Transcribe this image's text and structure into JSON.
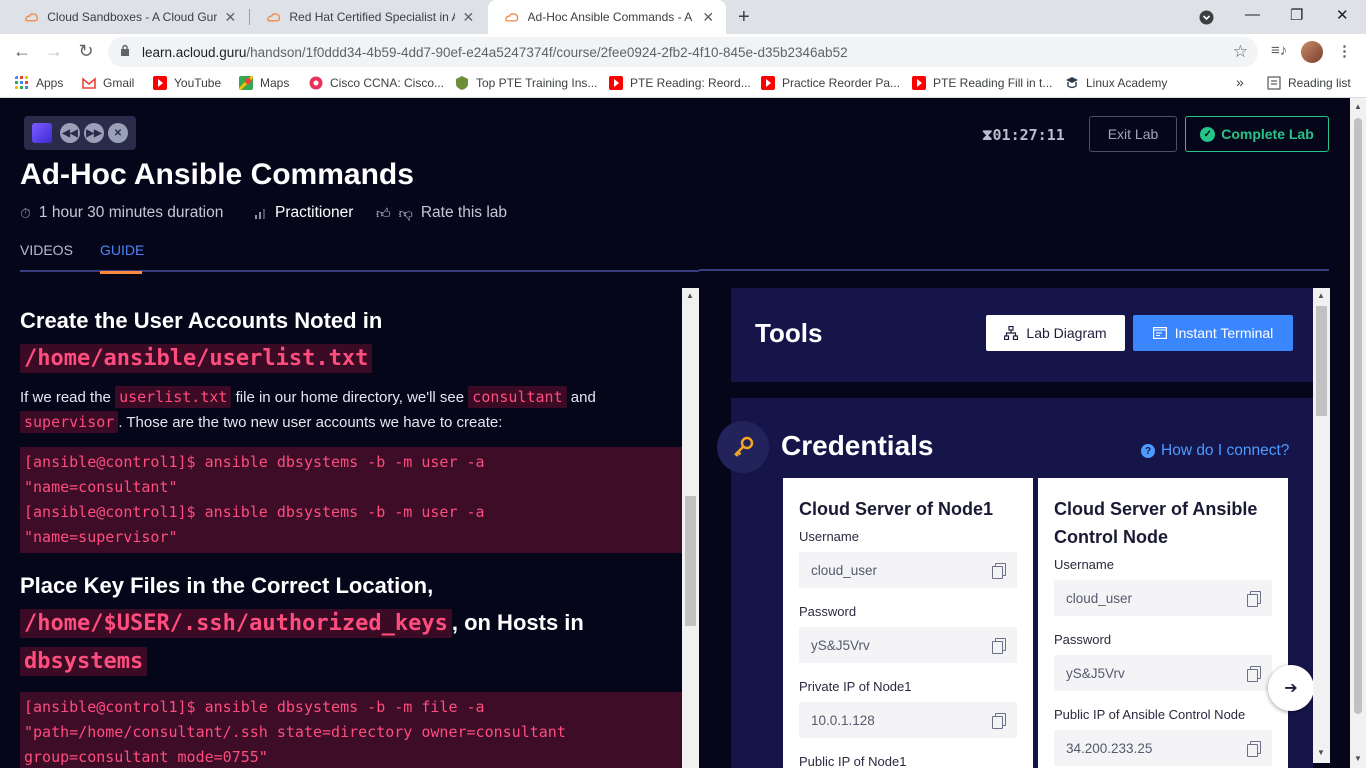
{
  "browser": {
    "tabs": [
      {
        "title": "Cloud Sandboxes - A Cloud Guru",
        "icon": "acloudguru-icon",
        "active": false
      },
      {
        "title": "Red Hat Certified Specialist in An",
        "icon": "acloudguru-icon",
        "active": false
      },
      {
        "title": "Ad-Hoc Ansible Commands - A C",
        "icon": "acloudguru-icon",
        "active": true
      }
    ],
    "url_host": "learn.acloud.guru",
    "url_path": "/handson/1f0ddd34-4b59-4dd7-90ef-e24a5247374f/course/2fee0924-2fb2-4f10-845e-d35b2346ab52",
    "bookmarks": [
      {
        "label": "Apps",
        "icon": "apps-grid-icon"
      },
      {
        "label": "Gmail",
        "icon": "gmail-icon"
      },
      {
        "label": "YouTube",
        "icon": "youtube-icon"
      },
      {
        "label": "Maps",
        "icon": "maps-icon"
      },
      {
        "label": "Cisco CCNA: Cisco...",
        "icon": "cisco-icon"
      },
      {
        "label": "Top PTE Training Ins...",
        "icon": "pte-icon"
      },
      {
        "label": "PTE Reading: Reord...",
        "icon": "youtube-icon"
      },
      {
        "label": "Practice Reorder Pa...",
        "icon": "youtube-icon"
      },
      {
        "label": "PTE Reading Fill in t...",
        "icon": "youtube-icon"
      },
      {
        "label": "Linux Academy",
        "icon": "linux-academy-icon"
      }
    ],
    "bookmarks_overflow": "»",
    "reading_list": "Reading list"
  },
  "header": {
    "timer": "01:27:11",
    "exit_label": "Exit Lab",
    "complete_label": "Complete Lab",
    "title": "Ad-Hoc Ansible Commands",
    "duration": "1 hour 30 minutes duration",
    "level": "Practitioner",
    "rate": "Rate this lab"
  },
  "nav_tabs": [
    {
      "label": "VIDEOS",
      "active": false
    },
    {
      "label": "GUIDE",
      "active": true
    }
  ],
  "guide": {
    "section1_heading": "Create the User Accounts Noted in",
    "section1_heading_code": "/home/ansible/userlist.txt",
    "para1_before": "If we read the ",
    "para1_code1": "userlist.txt",
    "para1_mid1": " file in our home directory, we'll see ",
    "para1_code2": "consultant",
    "para1_mid2": " and ",
    "para1_code3": "supervisor",
    "para1_after": ". Those are the two new user accounts we have to create:",
    "code1": [
      "[ansible@control1]$ ansible dbsystems -b -m user -a",
      "\"name=consultant\"",
      "[ansible@control1]$ ansible dbsystems -b -m user -a",
      "\"name=supervisor\""
    ],
    "section2_heading": "Place Key Files in the Correct Location,",
    "section2_code1": "/home/$USER/.ssh/authorized_keys",
    "section2_mid": ", on Hosts in",
    "section2_code2": "dbsystems",
    "code2": [
      "[ansible@control1]$ ansible dbsystems -b -m file -a",
      "\"path=/home/consultant/.ssh state=directory owner=consultant",
      "group=consultant mode=0755\""
    ]
  },
  "tools": {
    "title": "Tools",
    "lab_diagram": "Lab Diagram",
    "instant_terminal": "Instant Terminal"
  },
  "credentials": {
    "title": "Credentials",
    "help_link": "How do I connect?",
    "cards": [
      {
        "title": "Cloud Server of Node1",
        "fields": [
          {
            "label": "Username",
            "value": "cloud_user"
          },
          {
            "label": "Password",
            "value": "yS&J5Vrv"
          },
          {
            "label": "Private IP of Node1",
            "value": "10.0.1.128"
          },
          {
            "label": "Public IP of Node1",
            "value": ""
          }
        ]
      },
      {
        "title": "Cloud Server of Ansible Control Node",
        "fields": [
          {
            "label": "Username",
            "value": "cloud_user"
          },
          {
            "label": "Password",
            "value": "yS&J5Vrv"
          },
          {
            "label": "Public IP of Ansible Control Node",
            "value": "34.200.233.25"
          }
        ]
      }
    ]
  },
  "colors": {
    "page_bg": "#06061b",
    "panel_bg": "#15154a",
    "accent_blue": "#3a86ff",
    "success_green": "#27c487",
    "code_pink": "#ff4d7e",
    "tab_underline": "#ff8a3d"
  }
}
